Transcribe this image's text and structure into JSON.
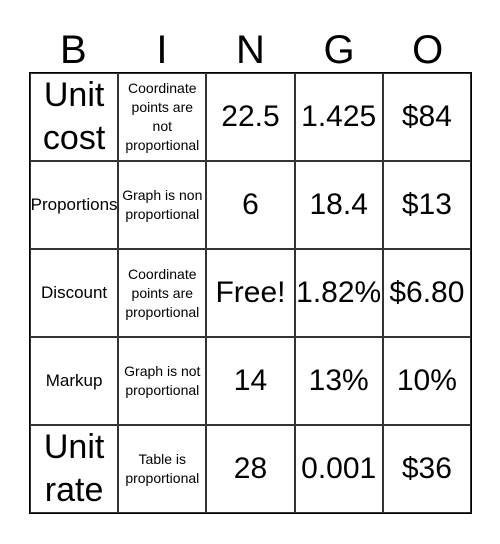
{
  "header": [
    "B",
    "I",
    "N",
    "G",
    "O"
  ],
  "cells": [
    [
      "Unit cost",
      "Coordinate points are not proportional",
      "22.5",
      "1.425",
      "$84"
    ],
    [
      "Proportions",
      "Graph is non proportional",
      "6",
      "18.4",
      "$13"
    ],
    [
      "Discount",
      "Coordinate points are proportional",
      "Free!",
      "1.82%",
      "$6.80"
    ],
    [
      "Markup",
      "Graph is not proportional",
      "14",
      "13%",
      "10%"
    ],
    [
      "Unit rate",
      "Table is proportional",
      "28",
      "0.001",
      "$36"
    ]
  ]
}
